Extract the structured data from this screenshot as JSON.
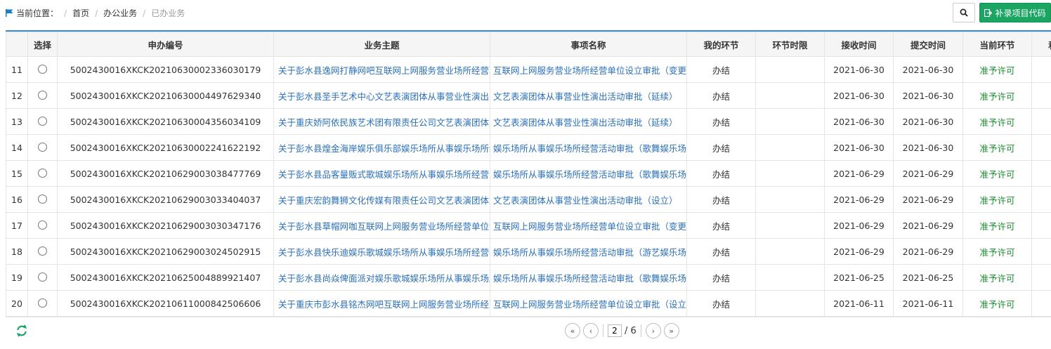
{
  "breadcrumb": {
    "label": "当前位置：",
    "items": [
      "首页",
      "办公业务",
      "已办业务"
    ]
  },
  "toolbar": {
    "add_label": "补录项目代码"
  },
  "table": {
    "headers": [
      "选择",
      "申办编号",
      "业务主题",
      "事项名称",
      "我的环节",
      "环节时限",
      "接收时间",
      "提交时间",
      "当前环节",
      "和"
    ],
    "rows": [
      {
        "idx": "11",
        "id": "5002430016XKCK20210630002336030179",
        "subject": "关于彭水县逸网打静网吧互联网上网服务营业场所经营单",
        "item": "互联网上网服务营业场所经营单位设立审批（变更",
        "step": "办结",
        "limit": "",
        "received": "2021-06-30",
        "submitted": "2021-06-30",
        "current": "准予许可"
      },
      {
        "idx": "12",
        "id": "5002430016XKCK20210630004497629340",
        "subject": "关于彭水县圣手艺术中心文艺表演团体从事营业性演出",
        "item": "文艺表演团体从事营业性演出活动审批（延续）",
        "step": "办结",
        "limit": "",
        "received": "2021-06-30",
        "submitted": "2021-06-30",
        "current": "准予许可"
      },
      {
        "idx": "13",
        "id": "5002430016XKCK20210630004356034109",
        "subject": "关于重庆娇阿依民族艺术团有限责任公司文艺表演团体从",
        "item": "文艺表演团体从事营业性演出活动审批（延续）",
        "step": "办结",
        "limit": "",
        "received": "2021-06-30",
        "submitted": "2021-06-30",
        "current": "准予许可"
      },
      {
        "idx": "14",
        "id": "5002430016XKCK20210630002241622192",
        "subject": "关于彭水县煌金海岸娱乐俱乐部娱乐场所从事娱乐场所经",
        "item": "娱乐场所从事娱乐场所经营活动审批（歌舞娱乐场",
        "step": "办结",
        "limit": "",
        "received": "2021-06-30",
        "submitted": "2021-06-30",
        "current": "准予许可"
      },
      {
        "idx": "15",
        "id": "5002430016XKCK20210629003038477769",
        "subject": "关于彭水县品客量贩式歌城娱乐场所从事娱乐场所经营活",
        "item": "娱乐场所从事娱乐场所经营活动审批（歌舞娱乐场",
        "step": "办结",
        "limit": "",
        "received": "2021-06-29",
        "submitted": "2021-06-29",
        "current": "准予许可"
      },
      {
        "idx": "16",
        "id": "5002430016XKCK20210629003033404037",
        "subject": "关于重庆宏韵舞狮文化传媒有限责任公司文艺表演团体从",
        "item": "文艺表演团体从事营业性演出活动审批（设立）",
        "step": "办结",
        "limit": "",
        "received": "2021-06-29",
        "submitted": "2021-06-29",
        "current": "准予许可"
      },
      {
        "idx": "17",
        "id": "5002430016XKCK20210629003030347176",
        "subject": "关于彭水县草帽网咖互联网上网服务营业场所经营单位设",
        "item": "互联网上网服务营业场所经营单位设立审批（变更",
        "step": "办结",
        "limit": "",
        "received": "2021-06-29",
        "submitted": "2021-06-29",
        "current": "准予许可"
      },
      {
        "idx": "18",
        "id": "5002430016XKCK20210629003024502915",
        "subject": "关于彭水县快乐迪娱乐歌城娱乐场所从事娱乐场所经营活",
        "item": "娱乐场所从事娱乐场所经营活动审批（游艺娱乐场",
        "step": "办结",
        "limit": "",
        "received": "2021-06-29",
        "submitted": "2021-06-29",
        "current": "准予许可"
      },
      {
        "idx": "19",
        "id": "5002430016XKCK20210625004889921407",
        "subject": "关于彭水县尚焱俾面派对娱乐歌城娱乐场所从事娱乐场所",
        "item": "娱乐场所从事娱乐场所经营活动审批（歌舞娱乐场",
        "step": "办结",
        "limit": "",
        "received": "2021-06-25",
        "submitted": "2021-06-25",
        "current": "准予许可"
      },
      {
        "idx": "20",
        "id": "5002430016XKCK20210611000842506606",
        "subject": "关于重庆市彭水县铭杰网吧互联网上网服务营业场所经营",
        "item": "互联网上网服务营业场所经营单位设立审批（设立",
        "step": "办结",
        "limit": "",
        "received": "2021-06-11",
        "submitted": "2021-06-11",
        "current": "准予许可"
      }
    ]
  },
  "pager": {
    "current_page": "2",
    "total_label": "/ 6"
  },
  "colors": {
    "accent": "#3b8cd1",
    "link": "#2a6fb7",
    "status": "#1a8f2e",
    "add_button": "#1aa563"
  },
  "icons": [
    "flag-icon",
    "search-icon",
    "add-icon",
    "refresh-icon",
    "first-page-icon",
    "prev-page-icon",
    "next-page-icon",
    "last-page-icon"
  ]
}
